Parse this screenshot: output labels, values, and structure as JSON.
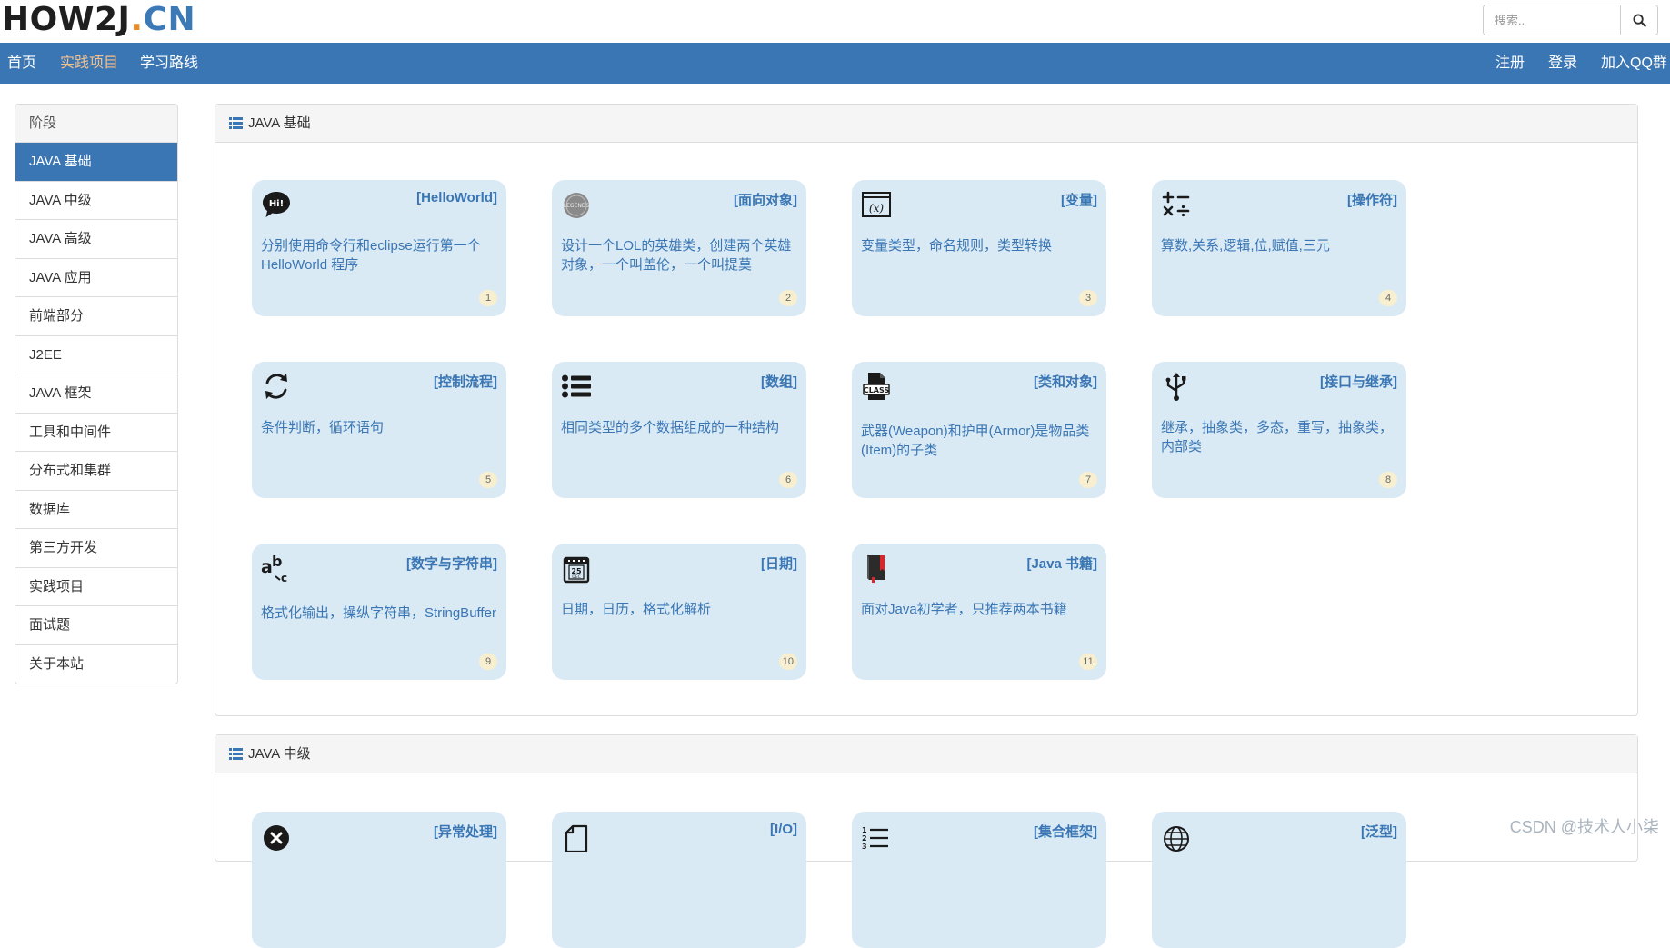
{
  "header": {
    "logo_main": "HOW2J",
    "logo_dot": ".",
    "logo_cn": "CN",
    "search_placeholder": "搜索.."
  },
  "nav": {
    "left": [
      "首页",
      "实践项目",
      "学习路线"
    ],
    "right": [
      "注册",
      "登录",
      "加入QQ群"
    ],
    "active_index": 1
  },
  "sidebar": {
    "header": "阶段",
    "items": [
      "JAVA 基础",
      "JAVA 中级",
      "JAVA 高级",
      "JAVA 应用",
      "前端部分",
      "J2EE",
      "JAVA 框架",
      "工具和中间件",
      "分布式和集群",
      "数据库",
      "第三方开发",
      "实践项目",
      "面试题",
      "关于本站"
    ],
    "active_index": 0
  },
  "sections": [
    {
      "title": "JAVA 基础",
      "cards": [
        {
          "title": "[HelloWorld]",
          "desc": "分别使用命令行和eclipse运行第一个HelloWorld 程序",
          "num": "1",
          "icon": "hi-speech-bubble-icon"
        },
        {
          "title": "[面向对象]",
          "desc": "设计一个LOL的英雄类，创建两个英雄对象，一个叫盖伦，一个叫提莫",
          "num": "2",
          "icon": "lol-logo-icon"
        },
        {
          "title": "[变量]",
          "desc": "变量类型，命名规则，类型转换",
          "num": "3",
          "icon": "variable-x-icon"
        },
        {
          "title": "[操作符]",
          "desc": "算数,关系,逻辑,位,赋值,三元",
          "num": "4",
          "icon": "math-operators-icon"
        },
        {
          "title": "[控制流程]",
          "desc": "条件判断，循环语句",
          "num": "5",
          "icon": "loop-arrows-icon"
        },
        {
          "title": "[数组]",
          "desc": "相同类型的多个数据组成的一种结构",
          "num": "6",
          "icon": "list-icon"
        },
        {
          "title": "[类和对象]",
          "desc": "武器(Weapon)和护甲(Armor)是物品类(Item)的子类",
          "num": "7",
          "icon": "class-file-icon"
        },
        {
          "title": "[接口与继承]",
          "desc": "继承，抽象类，多态，重写，抽象类，内部类",
          "num": "8",
          "icon": "usb-icon"
        },
        {
          "title": "[数字与字符串]",
          "desc": "格式化输出，操纵字符串，StringBuffer",
          "num": "9",
          "icon": "abc-text-icon"
        },
        {
          "title": "[日期]",
          "desc": "日期，日历，格式化解析",
          "num": "10",
          "icon": "calendar-icon"
        },
        {
          "title": "[Java 书籍]",
          "desc": "面对Java初学者，只推荐两本书籍",
          "num": "11",
          "icon": "book-icon"
        }
      ]
    },
    {
      "title": "JAVA 中级",
      "cards": [
        {
          "title": "[异常处理]",
          "icon": "error-x-icon"
        },
        {
          "title": "[I/O]",
          "icon": "file-icon"
        },
        {
          "title": "[集合框架]",
          "icon": "numbered-list-icon"
        },
        {
          "title": "[泛型]",
          "icon": "globe-icon"
        }
      ]
    }
  ],
  "watermark": "CSDN @技术人小柒"
}
